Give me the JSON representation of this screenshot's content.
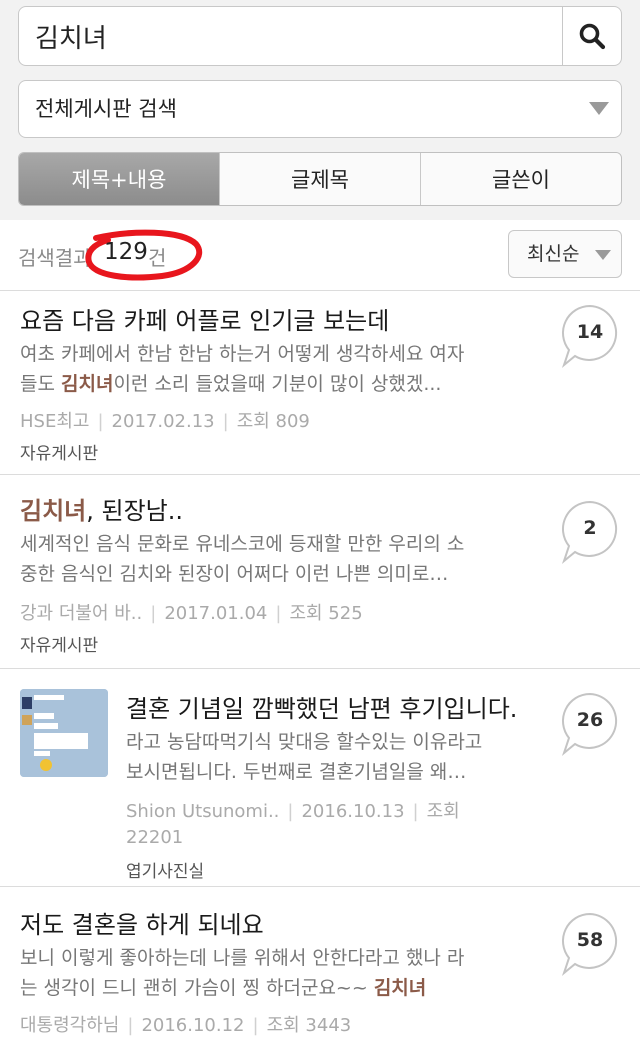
{
  "search": {
    "query": "김치녀"
  },
  "board_select": {
    "selected": "전체게시판 검색"
  },
  "search_scope": {
    "tabs": [
      {
        "label": "제목+내용",
        "active": true
      },
      {
        "label": "글제목",
        "active": false
      },
      {
        "label": "글쓴이",
        "active": false
      }
    ]
  },
  "results": {
    "label": "검색결과",
    "count": "129",
    "unit": "건"
  },
  "sort": {
    "label": "최신순"
  },
  "posts": [
    {
      "title": "요즘 다음 카페 어플로 인기글 보는데",
      "snippet_line1": "여초 카페에서 한남 한남 하는거 어떻게 생각하세요 여자",
      "snippet_line2_pre": "들도 ",
      "snippet_line2_hl": "김치녀",
      "snippet_line2_post": "이런 소리 들었을때 기분이 많이 상했겠...",
      "author": "HSE최고",
      "date": "2017.02.13",
      "views": "조회 809",
      "board": "자유게시판",
      "comments": "14"
    },
    {
      "title_hl": "김치녀",
      "title_post": ", 된장남..",
      "snippet_line1": "세계적인 음식 문화로 유네스코에 등재할 만한 우리의 소",
      "snippet_line2": "중한 음식인 김치와 된장이 어쩌다 이런 나쁜 의미로…",
      "author": "강과 더불어 바..",
      "date": "2017.01.04",
      "views": "조회 525",
      "board": "자유게시판",
      "comments": "2"
    },
    {
      "title": "결혼 기념일 깜빡했던 남편 후기입니다.",
      "snippet_line1": "라고 농담따먹기식 맞대응 할수있는 이유라고",
      "snippet_line2": "보시면됩니다. 두번째로 결혼기념일을 왜…",
      "author": "Shion Utsunomi..",
      "date": "2016.10.13",
      "views_label": "조회",
      "views_value": "22201",
      "board": "엽기사진실",
      "comments": "26"
    },
    {
      "title": "저도 결혼을 하게 되네요",
      "snippet_line1": "보니 이렇게 좋아하는데 나를 위해서 안한다라고 했나 라",
      "snippet_line2_pre": "는 생각이 드니 괜히 가슴이 찡 하더군요~~ ",
      "snippet_line2_hl": "김치녀",
      "author": "대통령각하님",
      "date": "2016.10.12",
      "views": "조회 3443",
      "comments": "58"
    }
  ]
}
